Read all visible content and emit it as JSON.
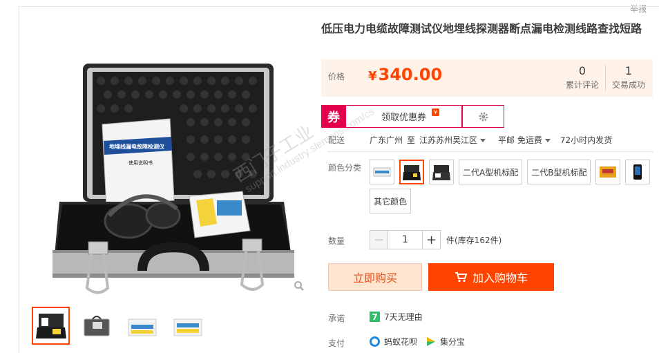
{
  "report_label": "举报",
  "title": "低压电力电缆故障测试仪地埋线探测器断点漏电检测线路查找短路",
  "price": {
    "label": "价格",
    "currency": "¥",
    "value": "340.00"
  },
  "stats": [
    {
      "num": "0",
      "label": "累计评论"
    },
    {
      "num": "1",
      "label": "交易成功"
    }
  ],
  "coupon": {
    "tag": "券",
    "button": "领取优惠券",
    "badge": "¥"
  },
  "delivery": {
    "label": "配送",
    "from": "广东广州",
    "to_word": "至",
    "to": "江苏苏州吴江区",
    "shipping": "平邮 免运费",
    "dispatch": "72小时内发货"
  },
  "colors": {
    "label": "颜色分类",
    "options": [
      "二代A型机标配",
      "二代B型机标配",
      "其它颜色"
    ]
  },
  "quantity": {
    "label": "数量",
    "value": "1",
    "stock": "件(库存162件)",
    "minus": "−",
    "plus": "+"
  },
  "buttons": {
    "buy_now": "立即购买",
    "add_cart": "加入购物车"
  },
  "promise": {
    "label": "承诺",
    "badge": "7",
    "text": "7天无理由"
  },
  "payment": {
    "label": "支付",
    "methods": [
      "蚂蚁花呗",
      "集分宝"
    ]
  },
  "manual": {
    "title": "地埋线漏电故障检测仪",
    "subtitle": "使用说明书"
  },
  "watermark": {
    "line1": "西门子工业",
    "line2": "support.industry.siemens.com/cs"
  },
  "accent_color": "#ff4400"
}
